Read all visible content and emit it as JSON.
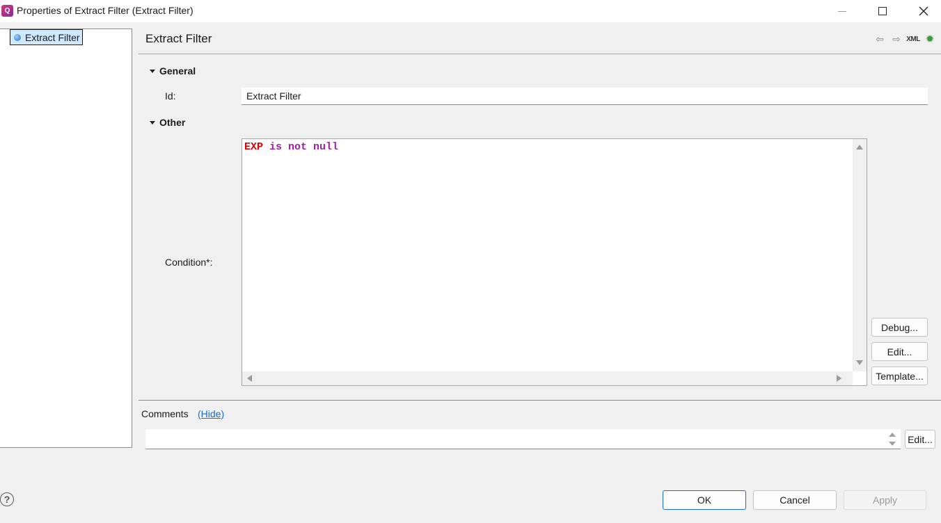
{
  "window": {
    "app_icon_letter": "Q",
    "title": "Properties of Extract Filter (Extract Filter)"
  },
  "tree": {
    "items": [
      {
        "label": "Extract Filter"
      }
    ]
  },
  "pane": {
    "title": "Extract Filter",
    "toolbar": {
      "back": "⇦",
      "forward": "⇨",
      "xml": "XML",
      "debug": "✹"
    }
  },
  "sections": {
    "general": "General",
    "other": "Other"
  },
  "fields": {
    "id_label": "Id:",
    "id_value": "Extract Filter",
    "condition_label": "Condition*:",
    "condition_tokens": [
      {
        "text": "EXP",
        "kind": "variable"
      },
      {
        "text": " is not null",
        "kind": "keyword"
      }
    ]
  },
  "condition_buttons": {
    "debug": "Debug...",
    "edit": "Edit...",
    "template": "Template..."
  },
  "comments": {
    "label": "Comments",
    "hide_link": "(Hide)",
    "value": "",
    "edit": "Edit..."
  },
  "footer": {
    "help": "?",
    "ok": "OK",
    "cancel": "Cancel",
    "apply": "Apply"
  },
  "colors": {
    "variable": "#e00000",
    "keyword": "#a020a0",
    "link": "#1a6ec8",
    "selection": "#cde8ff"
  }
}
